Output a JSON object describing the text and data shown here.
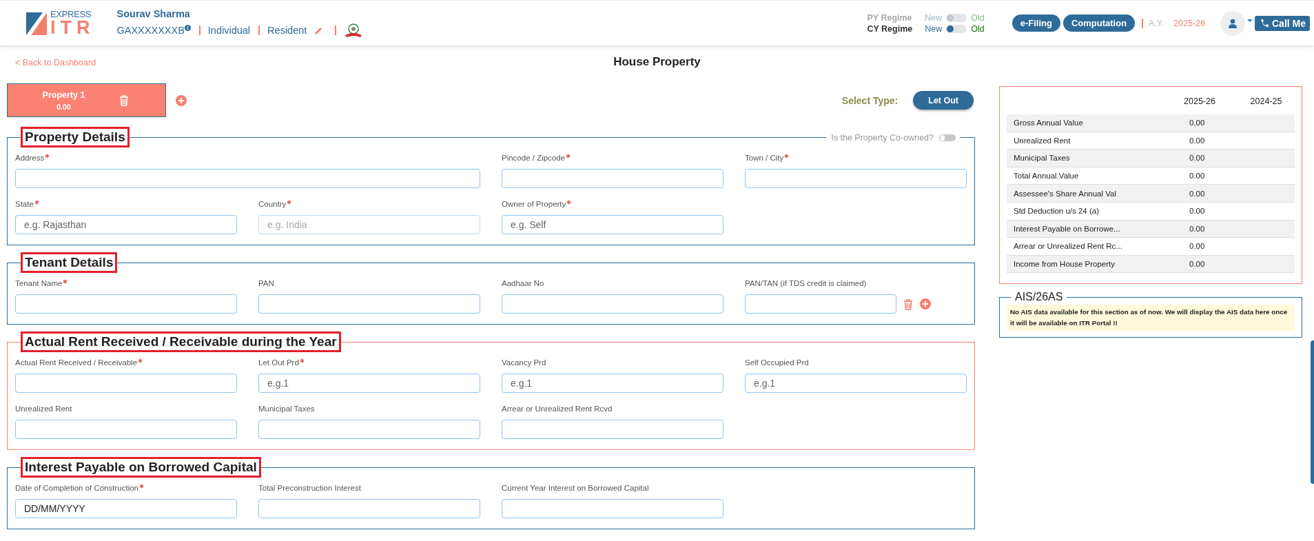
{
  "header": {
    "logo": {
      "top": "EXPRESS",
      "bottom": "ITR"
    },
    "user_name": "Sourav Sharma",
    "pan": "GAXXXXXXXB",
    "tags": [
      "Individual",
      "Resident"
    ],
    "regimes": [
      {
        "label": "PY Regime",
        "left": "New",
        "right": "Old",
        "on": false,
        "disabled": true
      },
      {
        "label": "CY Regime",
        "left": "New",
        "right": "Old",
        "on": false,
        "disabled": false
      }
    ],
    "buttons": [
      "e-Filing",
      "Computation"
    ],
    "ay_label": "A.Y.",
    "ay_value": "2025-26",
    "call_button": "Call Me"
  },
  "back_link": "< Back to Dashboard",
  "page_title": "House Property",
  "properties": [
    {
      "name": "Property 1",
      "amount": "0.00",
      "selected": true
    }
  ],
  "select_type": {
    "label": "Select Type:",
    "value": "Let Out"
  },
  "sections": [
    {
      "title": "Property Details",
      "color": "#2e6b99",
      "coowned": {
        "label": "Is the Property Co-owned?",
        "on": false
      },
      "fields": [
        {
          "label": "Address",
          "required": true,
          "kind": "wide",
          "disabled": false
        },
        {
          "label": "Pincode / Zipcode",
          "required": true,
          "kind": "text",
          "disabled": false
        },
        {
          "label": "Town / City",
          "required": true,
          "kind": "text",
          "disabled": false
        },
        {
          "label": "State",
          "required": true,
          "kind": "text",
          "placeholder": "e.g. Rajasthan",
          "disabled": false
        },
        {
          "label": "Country",
          "required": true,
          "kind": "text",
          "placeholder": "e.g. India",
          "disabled": true
        },
        {
          "label": "Owner of Property",
          "required": true,
          "kind": "text",
          "placeholder": "e.g. Self",
          "disabled": false
        }
      ]
    },
    {
      "title": "Tenant Details",
      "color": "#2e6b99",
      "fields": [
        {
          "label": "Tenant Name",
          "required": true,
          "kind": "text",
          "disabled": false
        },
        {
          "label": "PAN",
          "required": false,
          "kind": "text",
          "disabled": false
        },
        {
          "label": "Aadhaar No",
          "required": false,
          "kind": "text",
          "disabled": false
        },
        {
          "label": "PAN/TAN (if TDS credit is claimed)",
          "required": false,
          "kind": "actions",
          "disabled": false
        }
      ]
    },
    {
      "title": "Actual Rent Received / Receivable during the Year",
      "color": "#f4806f",
      "fields": [
        {
          "label": "Actual Rent Received / Receivable",
          "required": true,
          "kind": "text",
          "disabled": false
        },
        {
          "label": "Let Out Prd",
          "required": true,
          "kind": "text",
          "placeholder": "e.g.1",
          "disabled": false
        },
        {
          "label": "Vacancy Prd",
          "required": false,
          "kind": "text",
          "placeholder": "e.g.1",
          "disabled": false
        },
        {
          "label": "Self Occupied Prd",
          "required": false,
          "kind": "text",
          "placeholder": "e.g.1",
          "disabled": false
        },
        {
          "label": "Unrealized Rent",
          "required": false,
          "kind": "text",
          "disabled": false
        },
        {
          "label": "Municipal Taxes",
          "required": false,
          "kind": "text",
          "disabled": false
        },
        {
          "label": "Arrear or Unrealized Rent Rcvd",
          "required": false,
          "kind": "text",
          "disabled": false
        }
      ]
    },
    {
      "title": "Interest Payable on Borrowed Capital",
      "color": "#2e6b99",
      "fields": [
        {
          "label": "Date of Completion of Construction",
          "required": true,
          "kind": "date",
          "placeholder": "DD/MM/YYYY",
          "disabled": false
        },
        {
          "label": "Total Preconstruction Interest",
          "required": false,
          "kind": "text",
          "disabled": false
        },
        {
          "label": "Current Year Interest on Borrowed Capital",
          "required": false,
          "kind": "text",
          "disabled": false
        }
      ]
    }
  ],
  "summary": {
    "columns": [
      "2025-26",
      "2024-25"
    ],
    "rows": [
      {
        "label": "Gross Annual Value",
        "values": [
          "0.00"
        ]
      },
      {
        "label": "Unrealized Rent",
        "values": [
          "0.00"
        ]
      },
      {
        "label": "Municipal Taxes",
        "values": [
          "0.00"
        ]
      },
      {
        "label": "Total Annual Value",
        "values": [
          "0.00"
        ]
      },
      {
        "label": "Assessee's Share Annual Val",
        "values": [
          "0.00"
        ]
      },
      {
        "label": "Std Deduction u/s 24 (a)",
        "values": [
          "0.00"
        ]
      },
      {
        "label": "Interest Payable on Borrowe...",
        "values": [
          "0.00"
        ]
      },
      {
        "label": "Arrear or Unrealized Rent Rc...",
        "values": [
          "0.00"
        ]
      },
      {
        "label": "Income from House Property",
        "values": [
          "0.00"
        ]
      }
    ]
  },
  "ais": {
    "title": "AIS/26AS",
    "message": "No AIS data available for this section as of now. We will display the AIS data here once it will be available on ITR Portal !!"
  }
}
